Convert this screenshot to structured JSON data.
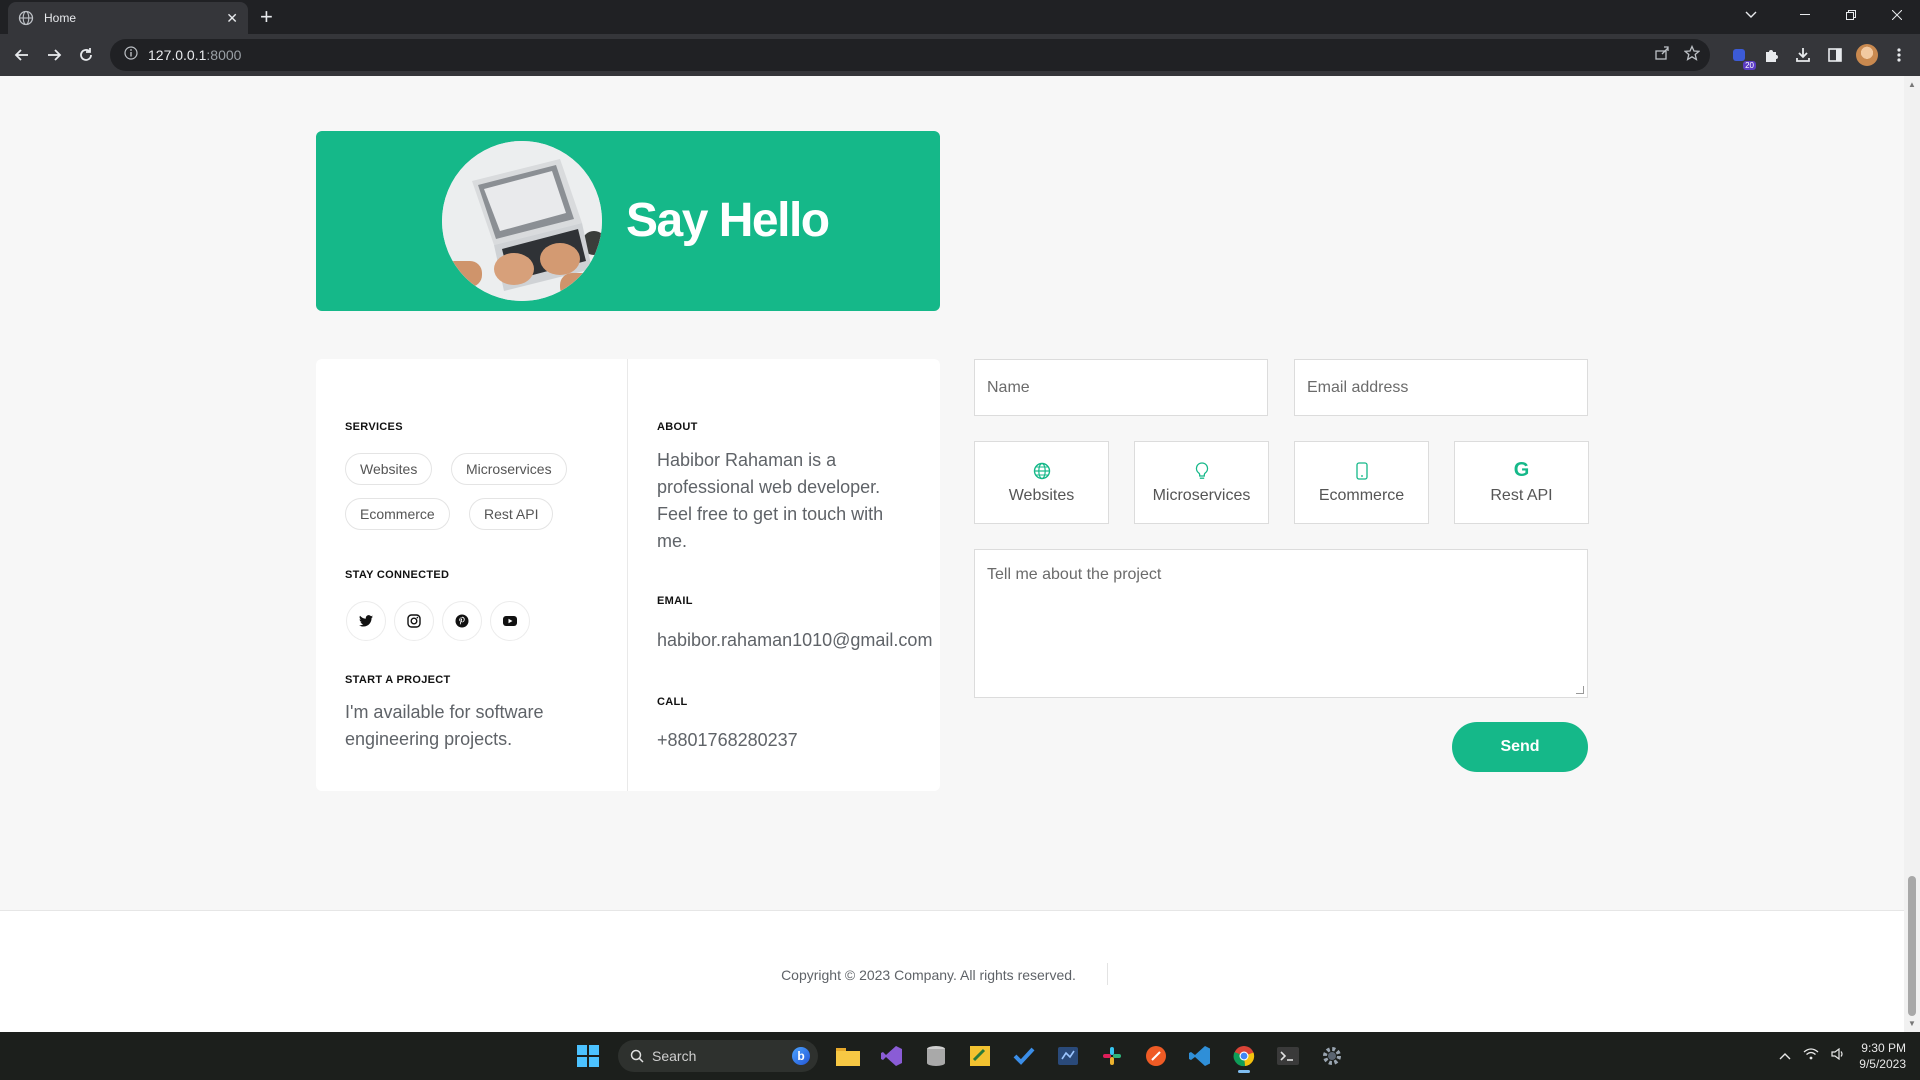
{
  "browser": {
    "tab_title": "Home",
    "url_host": "127.0.0.1",
    "url_port": ":8000",
    "extension_badge": "20"
  },
  "hero": {
    "title": "Say Hello"
  },
  "info": {
    "services_heading": "SERVICES",
    "services": [
      "Websites",
      "Microservices",
      "Ecommerce",
      "Rest API"
    ],
    "stay_connected_heading": "STAY CONNECTED",
    "social_icons": [
      "twitter-icon",
      "instagram-icon",
      "pinterest-icon",
      "youtube-icon"
    ],
    "start_project_heading": "START A PROJECT",
    "start_project_text": "I'm available for software engineering projects.",
    "about_heading": "ABOUT",
    "about_text": "Habibor Rahaman is a professional web developer. Feel free to get in touch with me.",
    "email_heading": "EMAIL",
    "email": "habibor.rahaman1010@gmail.com",
    "call_heading": "CALL",
    "phone": "+8801768280237"
  },
  "form": {
    "name_placeholder": "Name",
    "email_placeholder": "Email address",
    "service_options": [
      {
        "label": "Websites",
        "icon": "globe-icon"
      },
      {
        "label": "Microservices",
        "icon": "lightbulb-icon"
      },
      {
        "label": "Ecommerce",
        "icon": "mobile-icon"
      },
      {
        "label": "Rest API",
        "icon": "google-icon"
      }
    ],
    "message_placeholder": "Tell me about the project",
    "send_label": "Send"
  },
  "footer": {
    "copyright": "Copyright © 2023 Company. All rights reserved."
  },
  "taskbar": {
    "search_label": "Search",
    "time": "9:30 PM",
    "date": "9/5/2023"
  },
  "colors": {
    "accent": "#15b889"
  }
}
